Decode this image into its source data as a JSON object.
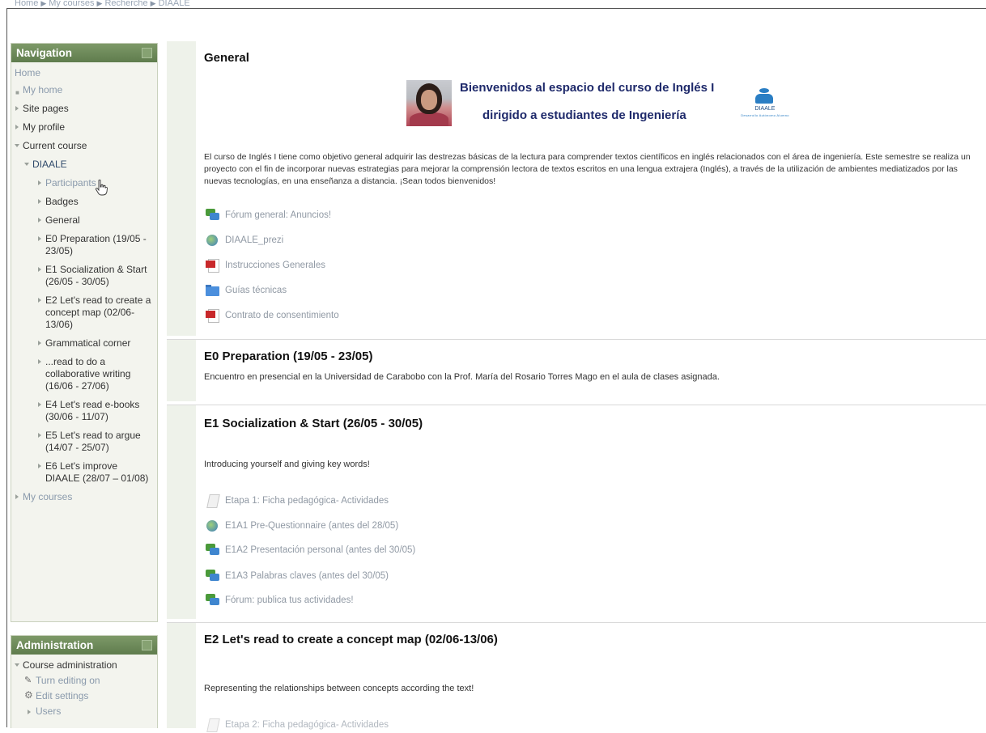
{
  "breadcrumb": [
    "Home",
    "My courses",
    "Recherche",
    "DIAALE"
  ],
  "breadcrumb_sep": "▶",
  "navigation": {
    "title": "Navigation",
    "items": [
      {
        "label": "Home"
      },
      {
        "label": "My home"
      },
      {
        "label": "Site pages"
      },
      {
        "label": "My profile"
      },
      {
        "label": "Current course"
      },
      {
        "label": "DIAALE"
      },
      {
        "label": "Participants"
      },
      {
        "label": "Badges"
      },
      {
        "label": "General"
      },
      {
        "label": "E0 Preparation (19/05 - 23/05)"
      },
      {
        "label": "E1 Socialization & Start (26/05 - 30/05)"
      },
      {
        "label": "E2 Let's read to create a concept map (02/06-13/06)"
      },
      {
        "label": "Grammatical corner"
      },
      {
        "label": "...read to do a collaborative writing (16/06 - 27/06)"
      },
      {
        "label": "E4 Let's read e-books (30/06 - 11/07)"
      },
      {
        "label": "E5 Let's read to argue (14/07 - 25/07)"
      },
      {
        "label": "E6 Let's improve DIAALE (28/07 – 01/08)"
      },
      {
        "label": "My courses"
      }
    ]
  },
  "administration": {
    "title": "Administration",
    "items": [
      {
        "label": "Course administration"
      },
      {
        "label": "Turn editing on"
      },
      {
        "label": "Edit settings"
      },
      {
        "label": "Users"
      }
    ]
  },
  "sections": {
    "general": {
      "title": "General",
      "banner_line1": "Bienvenidos al espacio del curso de Inglés I",
      "banner_line2": "dirigido a estudiantes de Ingeniería",
      "logo_text": "DIAALE",
      "logo_sub": "Desarrollo Autónomo Alumno",
      "description": "El curso de Inglés I tiene como objetivo general adquirir las destrezas básicas de la lectura para comprender textos científicos en inglés relacionados con el área de ingeniería. Este semestre se realiza un proyecto con el fin de incorporar nuevas estrategias para mejorar la comprensión lectora de textos escritos en una lengua extrajera (Inglés), a través de la utilización de ambientes mediatizados por las nuevas tecnologías, en una enseñanza a distancia. ¡Sean todos bienvenidos!",
      "activities": [
        {
          "label": "Fórum general: Anuncios!",
          "icon": "forum-icon"
        },
        {
          "label": "DIAALE_prezi",
          "icon": "url-icon"
        },
        {
          "label": "Instrucciones Generales",
          "icon": "pdf-icon"
        },
        {
          "label": "Guías técnicas",
          "icon": "folder-icon"
        },
        {
          "label": "Contrato de consentimiento",
          "icon": "pdf-icon"
        }
      ]
    },
    "e0": {
      "title": "E0 Preparation (19/05 - 23/05)",
      "description": "Encuentro en presencial en la Universidad de Carabobo con la Prof. María del Rosario Torres Mago en el aula de clases asignada."
    },
    "e1": {
      "title": "E1 Socialization & Start (26/05 - 30/05)",
      "description": "Introducing yourself and giving key words!",
      "activities": [
        {
          "label": "Etapa 1: Ficha pedagógica- Actividades",
          "icon": "page-icon"
        },
        {
          "label": "E1A1 Pre-Questionnaire (antes del 28/05)",
          "icon": "url-icon"
        },
        {
          "label": "E1A2 Presentación personal (antes del 30/05)",
          "icon": "forum-icon"
        },
        {
          "label": "E1A3 Palabras claves (antes del 30/05)",
          "icon": "forum-icon"
        },
        {
          "label": "Fórum: publica tus actividades!",
          "icon": "forum-icon"
        }
      ]
    },
    "e2": {
      "title": "E2 Let's read to create a concept map (02/06-13/06)",
      "description": "Representing the relationships between concepts according the text!",
      "activities": [
        {
          "label": "Etapa 2: Ficha pedagógica- Actividades",
          "icon": "page-icon"
        }
      ]
    }
  }
}
